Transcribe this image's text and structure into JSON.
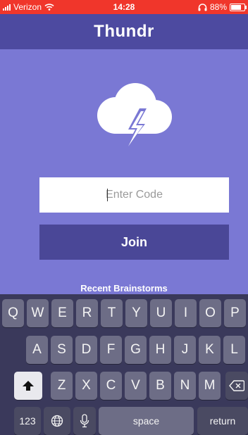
{
  "status_bar": {
    "carrier": "Verizon",
    "time": "14:28",
    "battery": "88%",
    "battery_level": 0.88
  },
  "nav": {
    "title": "Thundr"
  },
  "logo": {
    "icon": "cloud-lightning-icon"
  },
  "code_field": {
    "placeholder": "Enter Code",
    "value": ""
  },
  "join_label": "Join",
  "recent_label": "Recent Brainstorms",
  "keyboard": {
    "row1": [
      "Q",
      "W",
      "E",
      "R",
      "T",
      "Y",
      "U",
      "I",
      "O",
      "P"
    ],
    "row2": [
      "A",
      "S",
      "D",
      "F",
      "G",
      "H",
      "J",
      "K",
      "L"
    ],
    "row3": [
      "Z",
      "X",
      "C",
      "V",
      "B",
      "N",
      "M"
    ],
    "numbers_label": "123",
    "space_label": "space",
    "return_label": "return"
  },
  "colors": {
    "background": "#7a78d4",
    "nav": "#4d4aa0",
    "button": "#4a4797",
    "status_bar": "#f0362b"
  }
}
